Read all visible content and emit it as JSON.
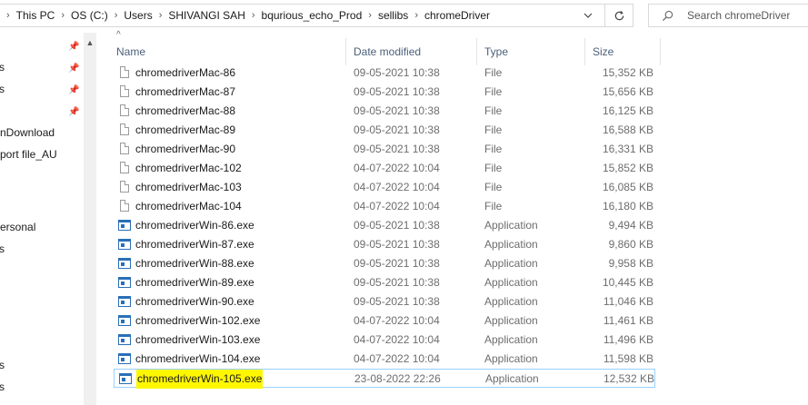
{
  "address": {
    "breadcrumbs": [
      "This PC",
      "OS (C:)",
      "Users",
      "SHIVANGI SAH",
      "bqurious_echo_Prod",
      "sellibs",
      "chromeDriver"
    ]
  },
  "search": {
    "placeholder": "Search chromeDriver"
  },
  "nav": {
    "items": [
      "s",
      "s",
      "nDownload",
      "port file_AU",
      "ersonal",
      "s",
      "s",
      "s"
    ]
  },
  "columns": {
    "name": "Name",
    "date": "Date modified",
    "type": "Type",
    "size": "Size"
  },
  "files": [
    {
      "name": "chromedriverMac-86",
      "date": "09-05-2021 10:38",
      "type": "File",
      "size": "15,352 KB",
      "icon": "file-icon"
    },
    {
      "name": "chromedriverMac-87",
      "date": "09-05-2021 10:38",
      "type": "File",
      "size": "15,656 KB",
      "icon": "file-icon"
    },
    {
      "name": "chromedriverMac-88",
      "date": "09-05-2021 10:38",
      "type": "File",
      "size": "16,125 KB",
      "icon": "file-icon"
    },
    {
      "name": "chromedriverMac-89",
      "date": "09-05-2021 10:38",
      "type": "File",
      "size": "16,588 KB",
      "icon": "file-icon"
    },
    {
      "name": "chromedriverMac-90",
      "date": "09-05-2021 10:38",
      "type": "File",
      "size": "16,331 KB",
      "icon": "file-icon"
    },
    {
      "name": "chromedriverMac-102",
      "date": "04-07-2022 10:04",
      "type": "File",
      "size": "15,852 KB",
      "icon": "file-icon"
    },
    {
      "name": "chromedriverMac-103",
      "date": "04-07-2022 10:04",
      "type": "File",
      "size": "16,085 KB",
      "icon": "file-icon"
    },
    {
      "name": "chromedriverMac-104",
      "date": "04-07-2022 10:04",
      "type": "File",
      "size": "16,180 KB",
      "icon": "file-icon"
    },
    {
      "name": "chromedriverWin-86.exe",
      "date": "09-05-2021 10:38",
      "type": "Application",
      "size": "9,494 KB",
      "icon": "application-icon"
    },
    {
      "name": "chromedriverWin-87.exe",
      "date": "09-05-2021 10:38",
      "type": "Application",
      "size": "9,860 KB",
      "icon": "application-icon"
    },
    {
      "name": "chromedriverWin-88.exe",
      "date": "09-05-2021 10:38",
      "type": "Application",
      "size": "9,958 KB",
      "icon": "application-icon"
    },
    {
      "name": "chromedriverWin-89.exe",
      "date": "09-05-2021 10:38",
      "type": "Application",
      "size": "10,445 KB",
      "icon": "application-icon"
    },
    {
      "name": "chromedriverWin-90.exe",
      "date": "09-05-2021 10:38",
      "type": "Application",
      "size": "11,046 KB",
      "icon": "application-icon"
    },
    {
      "name": "chromedriverWin-102.exe",
      "date": "04-07-2022 10:04",
      "type": "Application",
      "size": "11,461 KB",
      "icon": "application-icon"
    },
    {
      "name": "chromedriverWin-103.exe",
      "date": "04-07-2022 10:04",
      "type": "Application",
      "size": "11,496 KB",
      "icon": "application-icon"
    },
    {
      "name": "chromedriverWin-104.exe",
      "date": "04-07-2022 10:04",
      "type": "Application",
      "size": "11,598 KB",
      "icon": "application-icon"
    },
    {
      "name": "chromedriverWin-105.exe",
      "date": "23-08-2022 22:26",
      "type": "Application",
      "size": "12,532 KB",
      "icon": "application-icon",
      "selected": true,
      "highlighted": true
    }
  ],
  "colors": {
    "selection_border": "#99d1ff",
    "highlight": "#fff700",
    "header_text": "#4c607a"
  }
}
